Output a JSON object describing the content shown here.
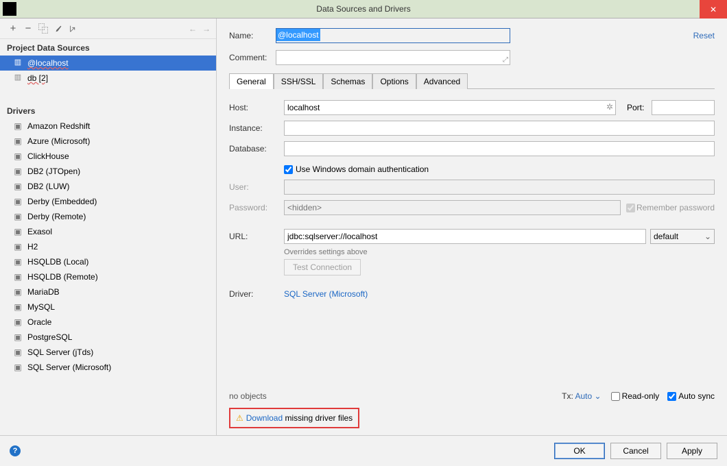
{
  "titlebar": {
    "title": "Data Sources and Drivers",
    "close": "✕"
  },
  "toolbar": {
    "add": "+",
    "remove": "−",
    "copy": "⿻",
    "wrench": "🔧",
    "collapse": "↙"
  },
  "left": {
    "projectHeader": "Project Data Sources",
    "driversHeader": "Drivers",
    "sources": [
      {
        "label": "@localhost",
        "selected": true,
        "underlined": true
      },
      {
        "label": "db [2]",
        "selected": false,
        "underlined": true
      }
    ],
    "drivers": [
      "Amazon Redshift",
      "Azure (Microsoft)",
      "ClickHouse",
      "DB2 (JTOpen)",
      "DB2 (LUW)",
      "Derby (Embedded)",
      "Derby (Remote)",
      "Exasol",
      "H2",
      "HSQLDB (Local)",
      "HSQLDB (Remote)",
      "MariaDB",
      "MySQL",
      "Oracle",
      "PostgreSQL",
      "SQL Server (jTds)",
      "SQL Server (Microsoft)"
    ]
  },
  "right": {
    "nameLabel": "Name:",
    "nameValue": "@localhost",
    "reset": "Reset",
    "commentLabel": "Comment:",
    "tabs": [
      "General",
      "SSH/SSL",
      "Schemas",
      "Options",
      "Advanced"
    ],
    "activeTab": 0,
    "hostLabel": "Host:",
    "hostValue": "localhost",
    "portLabel": "Port:",
    "portValue": "",
    "instanceLabel": "Instance:",
    "instanceValue": "",
    "databaseLabel": "Database:",
    "databaseValue": "",
    "winAuthLabel": "Use Windows domain authentication",
    "winAuthChecked": true,
    "userLabel": "User:",
    "passwordLabel": "Password:",
    "passwordPlaceholder": "<hidden>",
    "rememberLabel": "Remember password",
    "urlLabel": "URL:",
    "urlValue": "jdbc:sqlserver://localhost",
    "urlMode": "default",
    "urlNote": "Overrides settings above",
    "testConnection": "Test Connection",
    "driverLabel": "Driver:",
    "driverLink": "SQL Server (Microsoft)",
    "noObjects": "no objects",
    "txLabel": "Tx:",
    "txValue": "Auto",
    "readOnly": "Read-only",
    "autoSync": "Auto sync",
    "downloadLink": "Download",
    "downloadRest": " missing driver files"
  },
  "bottom": {
    "ok": "OK",
    "cancel": "Cancel",
    "apply": "Apply"
  }
}
